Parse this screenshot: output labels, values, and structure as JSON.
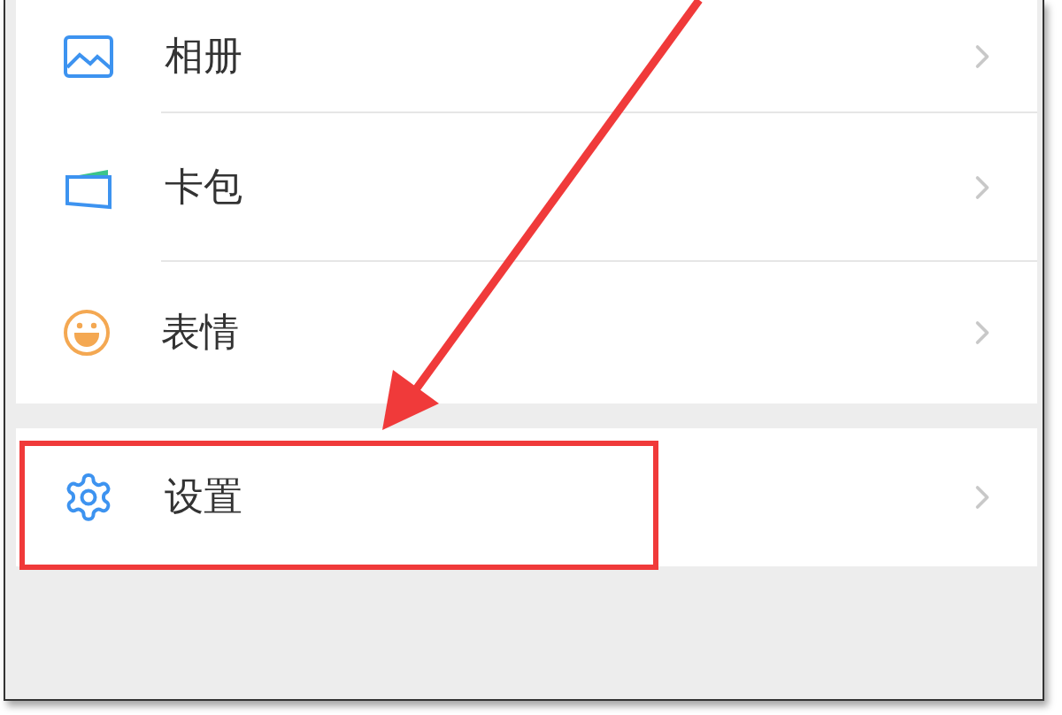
{
  "menu_groups": [
    {
      "items": [
        {
          "label": "相册",
          "kind": "album",
          "highlighted": false
        },
        {
          "label": "卡包",
          "kind": "wallet",
          "highlighted": false
        },
        {
          "label": "表情",
          "kind": "emoji",
          "highlighted": false
        }
      ]
    },
    {
      "items": [
        {
          "label": "设置",
          "kind": "settings",
          "highlighted": true
        }
      ]
    }
  ],
  "annotation_arrow": {
    "points_to_highlight": true
  }
}
